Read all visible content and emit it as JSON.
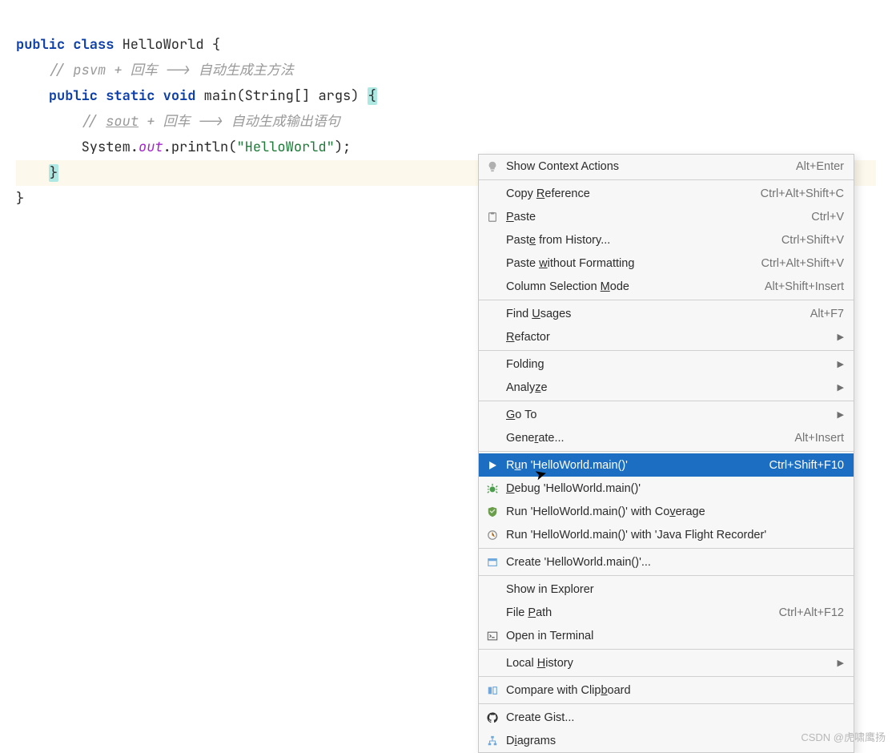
{
  "code": {
    "l1": {
      "kw1": "public",
      "kw2": "class",
      "cls": "HelloWorld",
      "brace": "{"
    },
    "l2": {
      "cmt": "// psvm + 回车 --> 自动生成主方法"
    },
    "l3": {
      "kw1": "public",
      "kw2": "static",
      "kw3": "void",
      "m": "main",
      "args": "(String[] args)",
      "brace": "{"
    },
    "l4": {
      "pre": "// ",
      "u": "sout",
      "post": " + 回车 --> 自动生成输出语句"
    },
    "l5": {
      "a": "System.",
      "b": "out",
      "c": ".println(",
      "d": "\"HelloWorld\"",
      "e": ");"
    },
    "l6": {
      "brace": "}"
    },
    "l7": {
      "brace": "}"
    }
  },
  "menu": {
    "groups": [
      [
        {
          "icon": "bulb",
          "label": "Show Context Actions",
          "shortcut": "Alt+Enter"
        }
      ],
      [
        {
          "label": "Copy <u>R</u>eference",
          "shortcut": "Ctrl+Alt+Shift+C"
        },
        {
          "icon": "paste",
          "label": "<u>P</u>aste",
          "shortcut": "Ctrl+V"
        },
        {
          "label": "Past<u>e</u> from History...",
          "shortcut": "Ctrl+Shift+V"
        },
        {
          "label": "Paste <u>w</u>ithout Formatting",
          "shortcut": "Ctrl+Alt+Shift+V"
        },
        {
          "label": "Column Selection <u>M</u>ode",
          "shortcut": "Alt+Shift+Insert"
        }
      ],
      [
        {
          "label": "Find <u>U</u>sages",
          "shortcut": "Alt+F7"
        },
        {
          "label": "<u>R</u>efactor",
          "arrow": true
        }
      ],
      [
        {
          "label": "Folding",
          "arrow": true
        },
        {
          "label": "Analy<u>z</u>e",
          "arrow": true
        }
      ],
      [
        {
          "label": "<u>G</u>o To",
          "arrow": true
        },
        {
          "label": "Gene<u>r</u>ate...",
          "shortcut": "Alt+Insert"
        }
      ],
      [
        {
          "icon": "run",
          "label": "R<u>u</u>n 'HelloWorld.main()'",
          "shortcut": "Ctrl+Shift+F10",
          "selected": true
        },
        {
          "icon": "debug",
          "label": "<u>D</u>ebug 'HelloWorld.main()'"
        },
        {
          "icon": "coverage",
          "label": "Run 'HelloWorld.main()' with Co<u>v</u>erage"
        },
        {
          "icon": "jfr",
          "label": "Run 'HelloWorld.main()' with 'Java Flight Recorder'"
        }
      ],
      [
        {
          "icon": "create",
          "label": "Create 'HelloWorld.main()'..."
        }
      ],
      [
        {
          "label": "Show in Explorer"
        },
        {
          "label": "File <u>P</u>ath",
          "shortcut": "Ctrl+Alt+F12"
        },
        {
          "icon": "terminal",
          "label": "Open in Terminal"
        }
      ],
      [
        {
          "label": "Local <u>H</u>istory",
          "arrow": true
        }
      ],
      [
        {
          "icon": "compare",
          "label": "Compare with Clip<u>b</u>oard"
        }
      ],
      [
        {
          "icon": "github",
          "label": "Create Gist..."
        },
        {
          "icon": "diagram",
          "label": "D<u>i</u>agrams"
        }
      ]
    ]
  },
  "watermark": "CSDN @虎啸鹰扬"
}
